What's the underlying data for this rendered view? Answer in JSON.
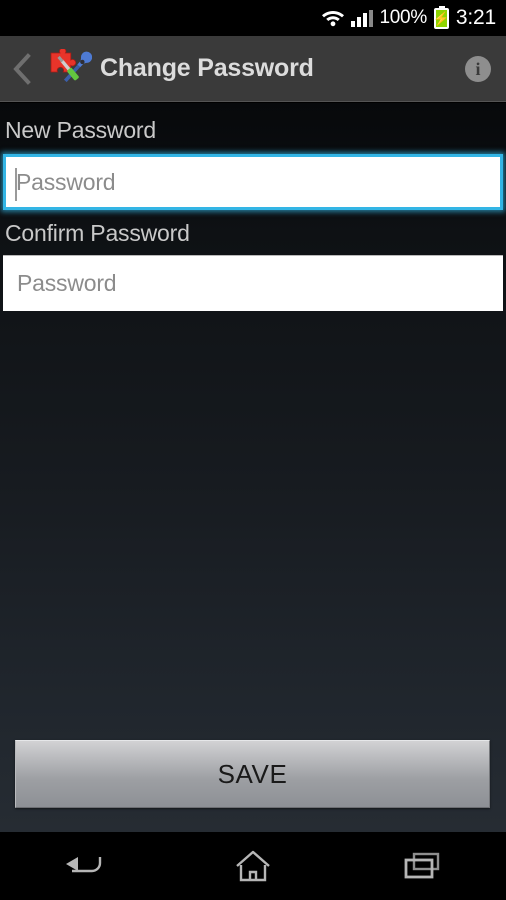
{
  "status_bar": {
    "wifi_icon": "wifi-icon",
    "signal_icon": "cellular-signal-icon",
    "battery_percent": "100%",
    "battery_icon": "battery-charging-icon",
    "clock": "3:21"
  },
  "action_bar": {
    "back_icon": "back-chevron-icon",
    "app_icon": "puzzle-tools-app-icon",
    "title": "Change Password",
    "info_icon": "info-icon",
    "info_glyph": "i",
    "background": "#3a3a3a"
  },
  "form": {
    "new_password": {
      "label": "New Password",
      "placeholder": "Password",
      "value": "",
      "focused": true,
      "focus_color": "#33b5e5"
    },
    "confirm_password": {
      "label": "Confirm Password",
      "placeholder": "Password",
      "value": "",
      "focused": false
    }
  },
  "save_button": {
    "label": "SAVE"
  },
  "nav_bar": {
    "back_icon": "nav-back-icon",
    "home_icon": "nav-home-icon",
    "recents_icon": "nav-recents-icon"
  }
}
